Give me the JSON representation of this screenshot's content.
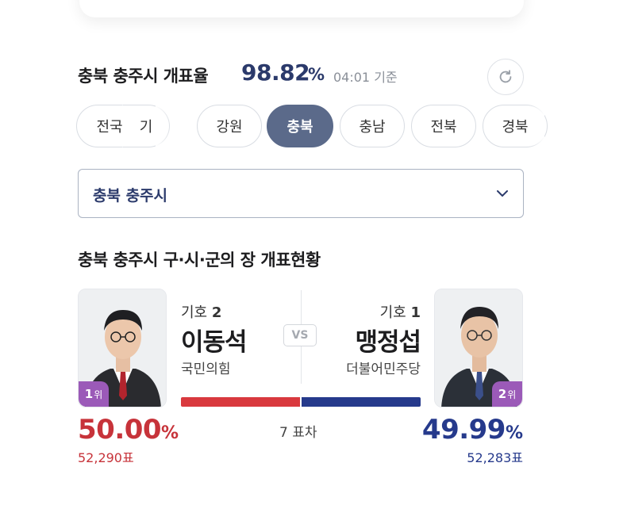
{
  "header": {
    "title": "충북 충주시 개표율",
    "rate": "98.82",
    "rate_unit": "%",
    "time": "04:01 기준",
    "refresh_icon": "refresh-icon"
  },
  "tabs": [
    {
      "label": "전국",
      "active": false
    },
    {
      "label": "기",
      "active": false
    },
    {
      "label": "강원",
      "active": false
    },
    {
      "label": "충북",
      "active": true
    },
    {
      "label": "충남",
      "active": false
    },
    {
      "label": "전북",
      "active": false
    },
    {
      "label": "경북",
      "active": false
    }
  ],
  "region_select": {
    "value": "충북 충주시",
    "icon": "chevron-down-icon"
  },
  "section_title": "충북 충주시 구·시·군의 장 개표현황",
  "candidates": {
    "left": {
      "giho_label": "기호",
      "giho_number": "2",
      "name": "이동석",
      "party": "국민의힘",
      "rank_number": "1",
      "rank_suffix": "위",
      "percent": "50.00",
      "percent_unit": "%",
      "votes": "52,290표",
      "color": "#c7333a"
    },
    "right": {
      "giho_label": "기호",
      "giho_number": "1",
      "name": "맹정섭",
      "party": "더불어민주당",
      "rank_number": "2",
      "rank_suffix": "위",
      "percent": "49.99",
      "percent_unit": "%",
      "votes": "52,283표",
      "color": "#263a8c"
    }
  },
  "vs_label": "VS",
  "vote_share": {
    "left": 0.5,
    "right": 0.4999
  },
  "margin_text": "7 표차",
  "colors": {
    "accent": "#5b6a8a",
    "left_party": "#d9393e",
    "right_party": "#263a8c",
    "rank_badge": "#9b5ab8"
  }
}
